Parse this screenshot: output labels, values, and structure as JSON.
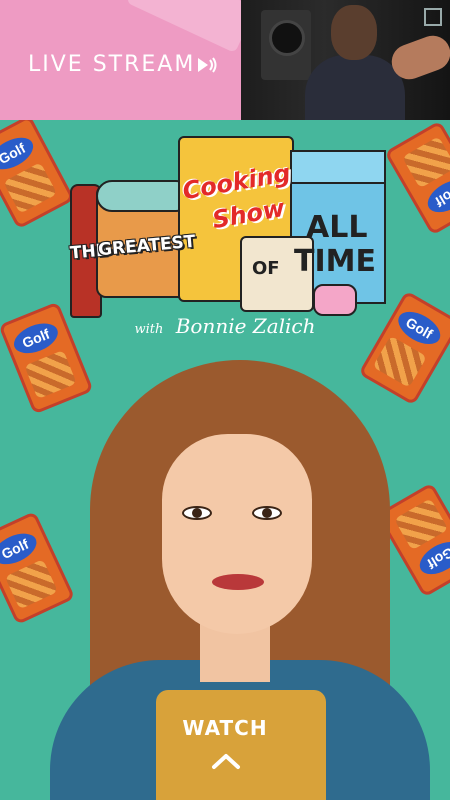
{
  "live": {
    "label": "LIVE STREAM",
    "icon": "play-audio-icon"
  },
  "show": {
    "title_words": [
      "THE",
      "GREATEST",
      "Cooking",
      "Show",
      "OF",
      "ALL",
      "TIME"
    ],
    "byline_with": "with",
    "byline_name": "Bonnie Zalich"
  },
  "chips": {
    "brand": "Golf"
  },
  "cta": {
    "label": "WATCH",
    "icon": "chevron-up-icon"
  },
  "colors": {
    "background": "#46b79c",
    "live_panel": "#ee9bc3",
    "title_red": "#e32a29"
  }
}
